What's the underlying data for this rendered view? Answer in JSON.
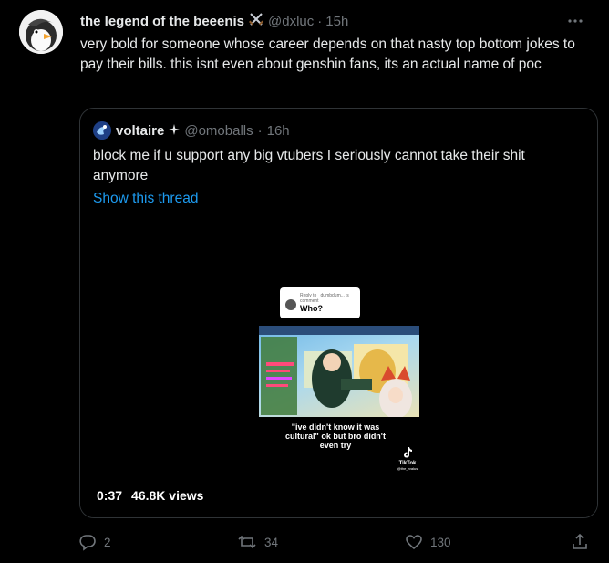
{
  "tweet": {
    "author_name": "the legend of the beeenis",
    "author_handle": "@dxluc",
    "dot": "·",
    "time": "15h",
    "text": "very bold for someone whose career depends on that nasty top bottom jokes to pay their bills. this isnt even about genshin fans, its an actual name of poc"
  },
  "quoted": {
    "author_name": "voltaire",
    "author_handle": "@omoballs",
    "dot": "·",
    "time": "16h",
    "text": "block me if u support any big vtubers I seriously cannot take their shit anymore",
    "show_thread": "Show this thread",
    "video": {
      "bubble_sub": "Reply to _dumbdum... 's comment",
      "bubble_who": "Who?",
      "caption": "\"ive didn't know it was cultural\" ok but bro didn't even try",
      "tiktok_label": "TikTok",
      "tiktok_handle": "@the_rvalus",
      "duration": "0:37",
      "views": "46.8K views"
    }
  },
  "actions": {
    "replies": "2",
    "retweets": "34",
    "likes": "130"
  },
  "colors": {
    "background": "#000000",
    "text": "#e7e9ea",
    "muted": "#71767b",
    "link": "#1d9bf0",
    "border": "#2f3336"
  }
}
